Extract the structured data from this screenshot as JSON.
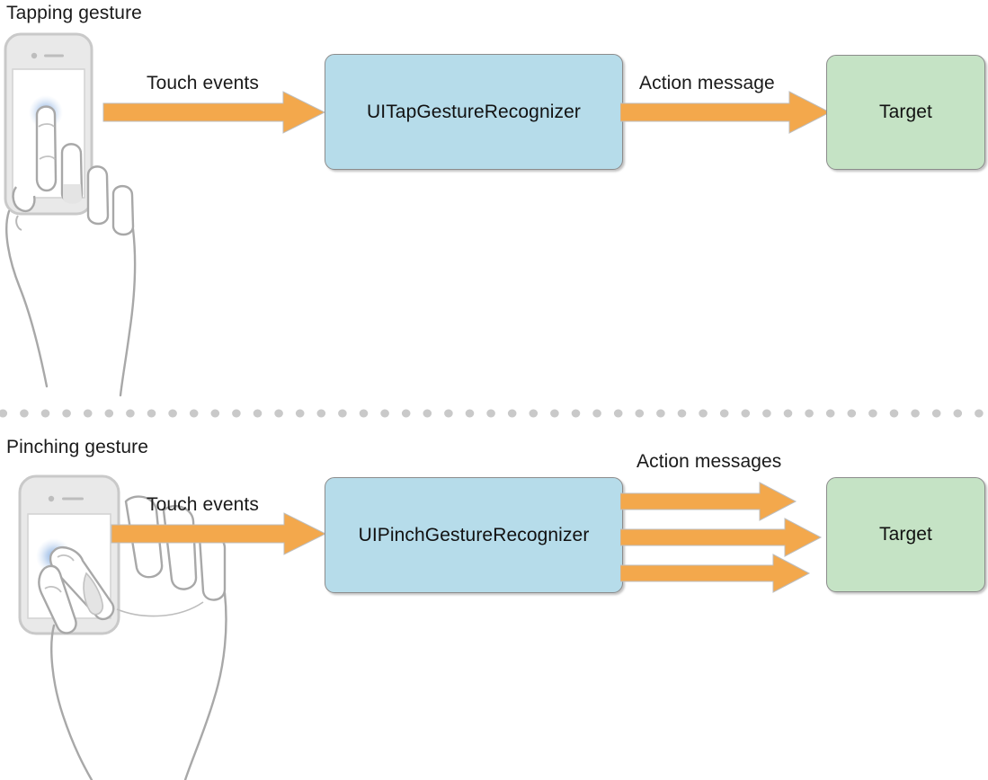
{
  "diagram": {
    "title": "Gesture recognizer flow diagram",
    "background_color": "#ffffff",
    "colors": {
      "arrow": "#F3A84C",
      "arrow_shadow": "#a8a8a8",
      "recognizer_fill": "#b6dcea",
      "target_fill": "#c5e3c5",
      "box_border": "#8c8c8c",
      "divider_dot": "#c9c9c9",
      "device_fill": "#e8e8e8",
      "device_stroke": "#c9c9c9",
      "hand_stroke": "#a8a8a8",
      "touch_glow": "#5b8fd4",
      "text": "#1a1a1a"
    }
  },
  "sections": [
    {
      "id": "tapping",
      "title": "Tapping gesture",
      "illustration": {
        "name": "tapping-hand-phone-illustration",
        "device": "smartphone",
        "gesture": "single-finger-tap",
        "touch_points": 1
      },
      "input_label": "Touch events",
      "recognizer": "UITapGestureRecognizer",
      "output_label": "Action message",
      "target": "Target",
      "output_arrow_count": 1
    },
    {
      "id": "pinching",
      "title": "Pinching gesture",
      "illustration": {
        "name": "pinching-hand-phone-illustration",
        "device": "smartphone",
        "gesture": "two-finger-pinch",
        "touch_points": 1
      },
      "input_label": "Touch events",
      "recognizer": "UIPinchGestureRecognizer",
      "output_label": "Action messages",
      "target": "Target",
      "output_arrow_count": 3
    }
  ]
}
